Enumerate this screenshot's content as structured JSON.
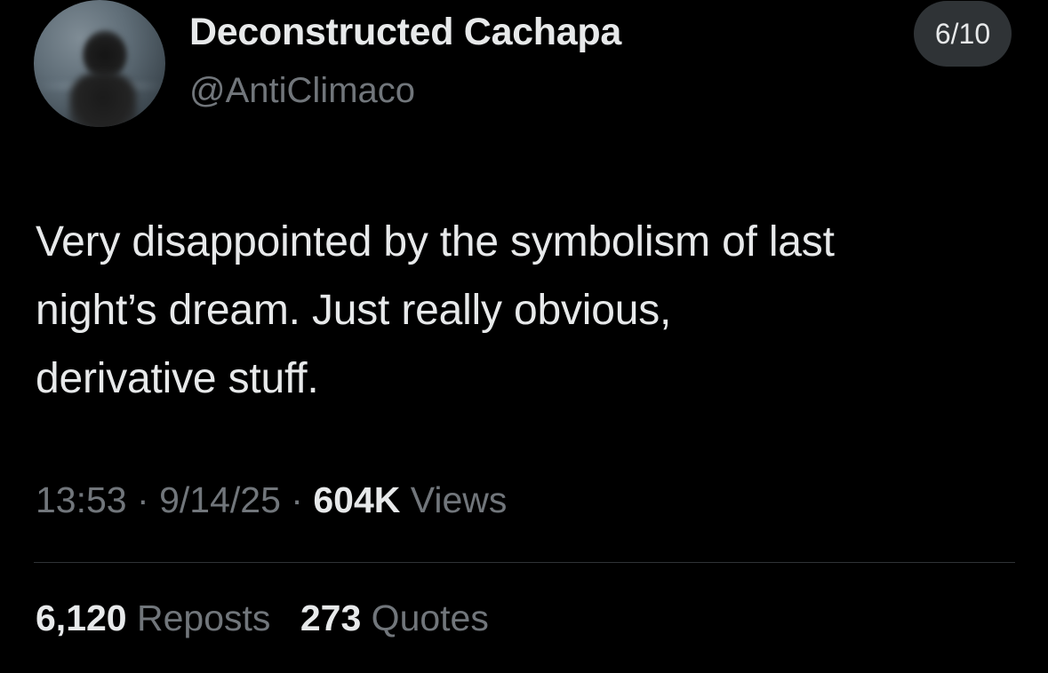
{
  "author": {
    "display_name": "Deconstructed Cachapa",
    "handle": "@AntiClimaco"
  },
  "pagination": {
    "label": "6/10"
  },
  "tweet": {
    "text_lines": [
      "Very disappointed by the symbolism of last",
      "night’s dream. Just really obvious,",
      "derivative stuff."
    ]
  },
  "meta": {
    "time": "13:53",
    "separator": "·",
    "date": "9/14/25",
    "views_count": "604K",
    "views_label": "Views"
  },
  "stats": {
    "reposts_count": "6,120",
    "reposts_label": "Reposts",
    "quotes_count": "273",
    "quotes_label": "Quotes"
  },
  "colors": {
    "background": "#000000",
    "primary_text": "#e7e9ea",
    "secondary_text": "#71767b",
    "divider": "#2f3336",
    "badge_background": "#2f3336"
  }
}
